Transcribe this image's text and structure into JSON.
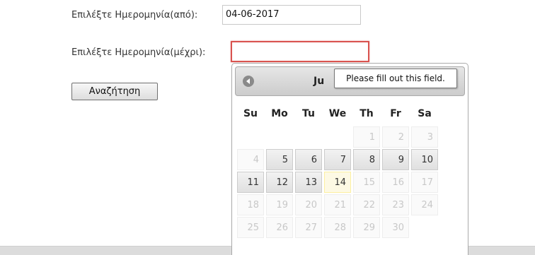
{
  "form": {
    "from_label": "Επιλέξτε Ημερομηνία(από):",
    "from_value": "04-06-2017",
    "to_label": "Επιλέξτε Ημερομηνία(μέχρι):",
    "to_value": "",
    "search_button": "Αναζήτηση"
  },
  "tooltip": {
    "text": "Please fill out this field."
  },
  "datepicker": {
    "title_visible": "Ju",
    "prev_icon": "circle-triangle-left-icon",
    "weekdays": [
      "Su",
      "Mo",
      "Tu",
      "We",
      "Th",
      "Fr",
      "Sa"
    ],
    "weeks": [
      [
        {
          "d": "",
          "s": "empty"
        },
        {
          "d": "",
          "s": "empty"
        },
        {
          "d": "",
          "s": "empty"
        },
        {
          "d": "",
          "s": "empty"
        },
        {
          "d": "1",
          "s": "disabled"
        },
        {
          "d": "2",
          "s": "disabled"
        },
        {
          "d": "3",
          "s": "disabled"
        }
      ],
      [
        {
          "d": "4",
          "s": "disabled"
        },
        {
          "d": "5",
          "s": "active"
        },
        {
          "d": "6",
          "s": "active"
        },
        {
          "d": "7",
          "s": "active"
        },
        {
          "d": "8",
          "s": "active"
        },
        {
          "d": "9",
          "s": "active"
        },
        {
          "d": "10",
          "s": "active"
        }
      ],
      [
        {
          "d": "11",
          "s": "active"
        },
        {
          "d": "12",
          "s": "active"
        },
        {
          "d": "13",
          "s": "active"
        },
        {
          "d": "14",
          "s": "today"
        },
        {
          "d": "15",
          "s": "disabled"
        },
        {
          "d": "16",
          "s": "disabled"
        },
        {
          "d": "17",
          "s": "disabled"
        }
      ],
      [
        {
          "d": "18",
          "s": "disabled"
        },
        {
          "d": "19",
          "s": "disabled"
        },
        {
          "d": "20",
          "s": "disabled"
        },
        {
          "d": "21",
          "s": "disabled"
        },
        {
          "d": "22",
          "s": "disabled"
        },
        {
          "d": "23",
          "s": "disabled"
        },
        {
          "d": "24",
          "s": "disabled"
        }
      ],
      [
        {
          "d": "25",
          "s": "disabled"
        },
        {
          "d": "26",
          "s": "disabled"
        },
        {
          "d": "27",
          "s": "disabled"
        },
        {
          "d": "28",
          "s": "disabled"
        },
        {
          "d": "29",
          "s": "disabled"
        },
        {
          "d": "30",
          "s": "disabled"
        },
        {
          "d": "",
          "s": "empty"
        }
      ]
    ]
  },
  "colors": {
    "invalid_border": "#d9534f",
    "today_bg": "#fdf9e4",
    "disabled_text": "#c8c8c8"
  }
}
